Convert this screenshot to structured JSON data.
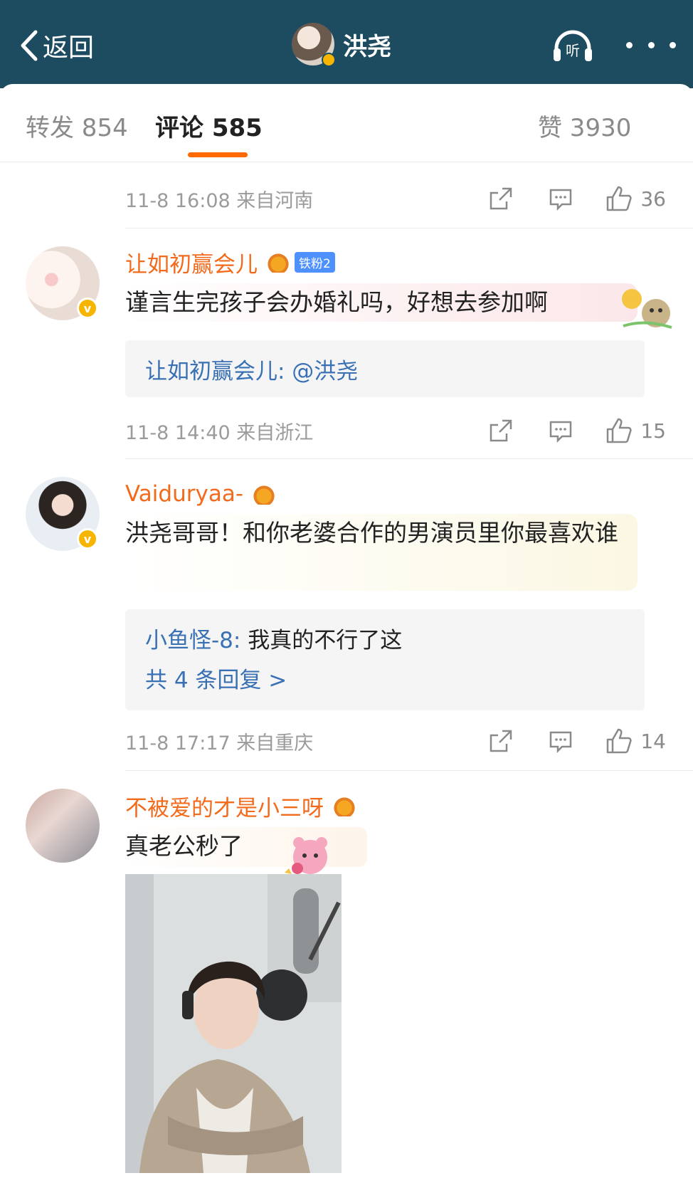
{
  "header": {
    "back_label": "返回",
    "title": "洪尧",
    "listen_icon": "headphones-icon",
    "more_icon": "more-dots-icon",
    "bg_color": "#1d4b5f"
  },
  "tabs": {
    "repost": "转发 854",
    "comments": "评论 585",
    "likes": "赞 3930",
    "accent": "#ff6a00"
  },
  "comments": [
    {
      "meta": "11-8 16:08 来自河南",
      "likes": "36"
    },
    {
      "user": "让如初赢会儿",
      "fan_badge": "铁粉2",
      "text": "谨言生完孩子会办婚礼吗，好想去参加啊",
      "reply_name": "让如初赢会儿:",
      "reply_text": " @洪尧",
      "meta": "11-8 14:40 来自浙江",
      "likes": "15"
    },
    {
      "user": "Vaiduryaa-",
      "text": "洪尧哥哥！和你老婆合作的男演员里你最喜欢谁",
      "reply_name": "小鱼怪-8:",
      "reply_text": " 我真的不行了这",
      "reply_more": "共 4 条回复 >",
      "meta": "11-8 17:17 来自重庆",
      "likes": "14"
    },
    {
      "user": "不被爱的才是小三呀",
      "text": "真老公秒了"
    }
  ]
}
